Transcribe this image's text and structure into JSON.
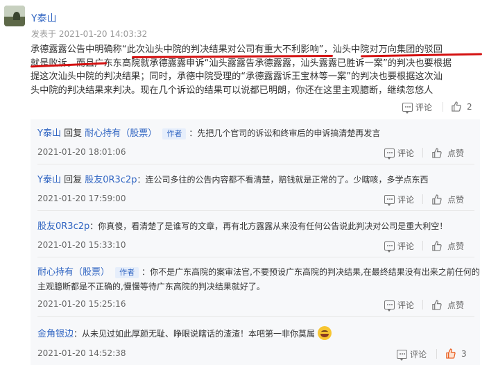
{
  "post": {
    "author": "Y泰山",
    "time": "发表于 2021-01-20 14:03:32",
    "lines": [
      "承德露露公告中明确称“此次汕头中院的判决结果对公司有重大不利影响”，汕头中院对万向集团的驳回",
      "就是败诉。而且广东东高院就承德露露申诉“汕头露露告承德露露，汕头露露已胜诉一案”的判决也要根据",
      "提这次汕头中院的判决结果；同时，承德中院受理的“承德露露诉王宝林等一案”的判决也要根据这次汕",
      "头中院的判决结果来判决。现在几个诉讼的结果可以说都已明朗，你还在这里主观臆断，继续忽悠人"
    ],
    "comment_label": "评论",
    "like_count": "2"
  },
  "replies": [
    {
      "user": "Y泰山",
      "reply_word": "回复",
      "target": "耐心持有（股票）",
      "tag": "作者",
      "text": "：先把几个官司的诉讼和终审后的申诉搞清楚再发言",
      "time": "2021-01-20 18:01:06",
      "comment": "评论",
      "like": "点赞"
    },
    {
      "user": "Y泰山",
      "reply_word": "回复",
      "target": "股友0R3c2p",
      "tag": "",
      "text": "：连公司多往的公告内容都不看清楚，赔钱就是正常的了。少瞎咳，多学点东西",
      "time": "2021-01-20 17:59:00",
      "comment": "评论",
      "like": "点赞"
    },
    {
      "user": "股友0R3c2p",
      "reply_word": "",
      "target": "",
      "tag": "",
      "text": "：你真傻，看清楚了是谁写的文章，再有北方露露从来没有任何公告说此判决对公司是重大利空！",
      "time": "2021-01-20 15:33:10",
      "comment": "评论",
      "like": "点赞"
    },
    {
      "user": "耐心持有（股票）",
      "reply_word": "",
      "target": "",
      "tag": "作者",
      "text": "：你不是广东高院的案审法官,不要预设广东高院的判决结果,在最终结果没有出来之前任何的",
      "text2": "主观臆断都是不正确的,慢慢等待广东高院的判决结果就好了。",
      "time": "2021-01-20 15:25:16",
      "comment": "评论",
      "like": "点赞"
    },
    {
      "user": "金角银边",
      "reply_word": "",
      "target": "",
      "tag": "",
      "text": "：从未见过如此厚颜无耻、睁眼说瞎话的渣渣！本吧第一非你莫属",
      "time": "2021-01-20 14:52:38",
      "comment": "评论",
      "like": "3",
      "liked": true
    }
  ],
  "icons": {
    "like_active_color": "#e8591a",
    "link_color": "#2f64c2",
    "underline_color": "#d41010"
  }
}
